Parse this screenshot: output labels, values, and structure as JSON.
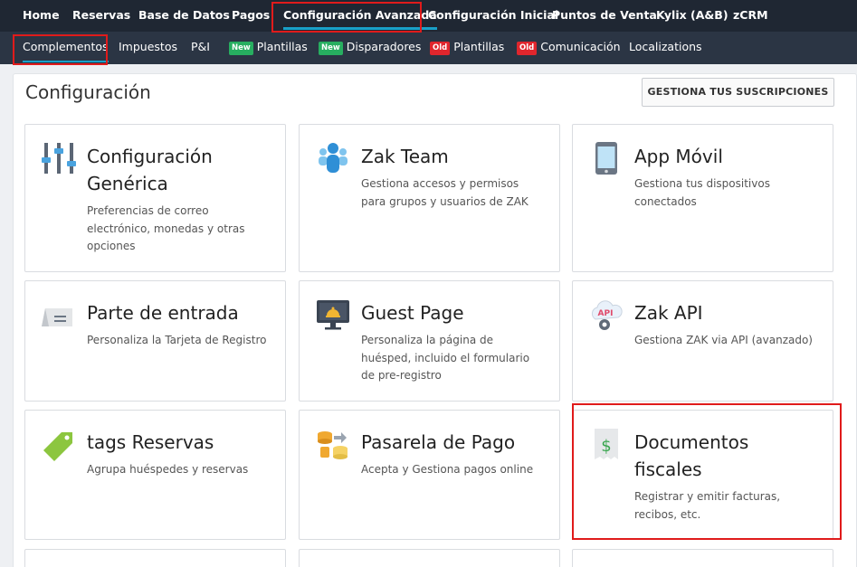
{
  "topnav": {
    "items": [
      {
        "label": "Home"
      },
      {
        "label": "Reservas"
      },
      {
        "label": "Base de Datos"
      },
      {
        "label": "Pagos"
      },
      {
        "label": "Configuración Avanzada"
      },
      {
        "label": "Configuración Inicial"
      },
      {
        "label": "Puntos de Venta"
      },
      {
        "label": "Kylix (A&B)"
      },
      {
        "label": "zCRM"
      }
    ]
  },
  "subnav": {
    "items": [
      {
        "label": "Complementos",
        "badge": ""
      },
      {
        "label": "Impuestos",
        "badge": ""
      },
      {
        "label": "P&I",
        "badge": ""
      },
      {
        "label": "Plantillas",
        "badge": "New"
      },
      {
        "label": "Disparadores",
        "badge": "New"
      },
      {
        "label": "Plantillas",
        "badge": "Old"
      },
      {
        "label": "Comunicación",
        "badge": "Old"
      },
      {
        "label": "Localizations",
        "badge": ""
      }
    ]
  },
  "page": {
    "title": "Configuración",
    "subscriptions_button": "GESTIONA TUS SUSCRIPCIONES"
  },
  "cards": [
    {
      "title": "Configuración Genérica",
      "desc": "Preferencias de correo electrónico, monedas y otras opciones",
      "icon": "sliders-icon"
    },
    {
      "title": "Zak Team",
      "desc": "Gestiona accesos y permisos para grupos y usuarios de ZAK",
      "icon": "team-icon"
    },
    {
      "title": "App Móvil",
      "desc": "Gestiona tus dispositivos conectados",
      "icon": "phone-icon"
    },
    {
      "title": "Parte de entrada",
      "desc": "Personaliza la Tarjeta de Registro",
      "icon": "card-icon"
    },
    {
      "title": "Guest Page",
      "desc": "Personaliza la página de huésped, incluido el formulario de pre-registro",
      "icon": "monitor-icon"
    },
    {
      "title": "Zak API",
      "desc": "Gestiona ZAK via API (avanzado)",
      "icon": "api-cloud-icon"
    },
    {
      "title": "tags Reservas",
      "desc": "Agrupa huéspedes y reservas",
      "icon": "tag-icon"
    },
    {
      "title": "Pasarela de Pago",
      "desc": "Acepta y Gestiona pagos online",
      "icon": "coins-icon"
    },
    {
      "title": "Documentos fiscales",
      "desc": "Registrar y emitir facturas, recibos, etc.",
      "icon": "receipt-icon"
    }
  ],
  "colors": {
    "topnav_bg": "#1f2733",
    "subnav_bg": "#2b3544",
    "accent": "#19a0c8",
    "highlight": "#e01b1b",
    "badge_new": "#27ae60",
    "badge_old": "#e0262d"
  }
}
